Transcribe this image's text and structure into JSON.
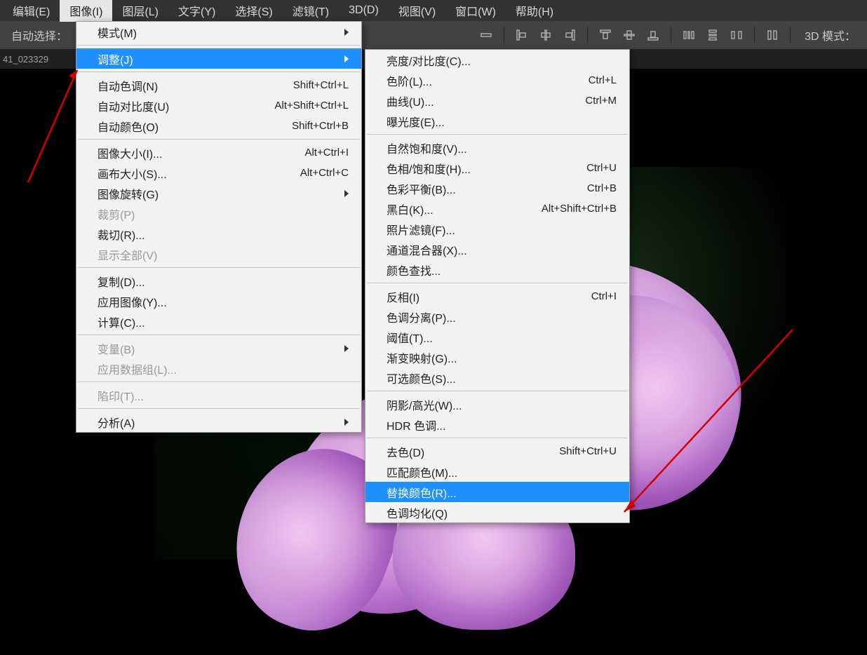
{
  "menubar": {
    "items": [
      {
        "label": "编辑(E)"
      },
      {
        "label": "图像(I)",
        "active": true
      },
      {
        "label": "图层(L)"
      },
      {
        "label": "文字(Y)"
      },
      {
        "label": "选择(S)"
      },
      {
        "label": "滤镜(T)"
      },
      {
        "label": "3D(D)"
      },
      {
        "label": "视图(V)"
      },
      {
        "label": "窗口(W)"
      },
      {
        "label": "帮助(H)"
      }
    ]
  },
  "optionsbar": {
    "auto_select_label": "自动选择：",
    "mode3d_label": "3D 模式："
  },
  "filetab": {
    "name": "41_023329"
  },
  "menu_main": {
    "items": [
      {
        "label": "模式(M)",
        "arrow": true
      },
      {
        "sep": true
      },
      {
        "label": "调整(J)",
        "arrow": true,
        "hover": true
      },
      {
        "sep": true
      },
      {
        "label": "自动色调(N)",
        "shortcut": "Shift+Ctrl+L"
      },
      {
        "label": "自动对比度(U)",
        "shortcut": "Alt+Shift+Ctrl+L"
      },
      {
        "label": "自动颜色(O)",
        "shortcut": "Shift+Ctrl+B"
      },
      {
        "sep": true
      },
      {
        "label": "图像大小(I)...",
        "shortcut": "Alt+Ctrl+I"
      },
      {
        "label": "画布大小(S)...",
        "shortcut": "Alt+Ctrl+C"
      },
      {
        "label": "图像旋转(G)",
        "arrow": true
      },
      {
        "label": "裁剪(P)",
        "disabled": true
      },
      {
        "label": "裁切(R)..."
      },
      {
        "label": "显示全部(V)",
        "disabled": true
      },
      {
        "sep": true
      },
      {
        "label": "复制(D)..."
      },
      {
        "label": "应用图像(Y)..."
      },
      {
        "label": "计算(C)..."
      },
      {
        "sep": true
      },
      {
        "label": "变量(B)",
        "arrow": true,
        "disabled": true
      },
      {
        "label": "应用数据组(L)...",
        "disabled": true
      },
      {
        "sep": true
      },
      {
        "label": "陷印(T)...",
        "disabled": true
      },
      {
        "sep": true
      },
      {
        "label": "分析(A)",
        "arrow": true
      }
    ]
  },
  "menu_sub": {
    "items": [
      {
        "label": "亮度/对比度(C)..."
      },
      {
        "label": "色阶(L)...",
        "shortcut": "Ctrl+L"
      },
      {
        "label": "曲线(U)...",
        "shortcut": "Ctrl+M"
      },
      {
        "label": "曝光度(E)..."
      },
      {
        "sep": true
      },
      {
        "label": "自然饱和度(V)..."
      },
      {
        "label": "色相/饱和度(H)...",
        "shortcut": "Ctrl+U"
      },
      {
        "label": "色彩平衡(B)...",
        "shortcut": "Ctrl+B"
      },
      {
        "label": "黑白(K)...",
        "shortcut": "Alt+Shift+Ctrl+B"
      },
      {
        "label": "照片滤镜(F)..."
      },
      {
        "label": "通道混合器(X)..."
      },
      {
        "label": "颜色查找..."
      },
      {
        "sep": true
      },
      {
        "label": "反相(I)",
        "shortcut": "Ctrl+I"
      },
      {
        "label": "色调分离(P)..."
      },
      {
        "label": "阈值(T)..."
      },
      {
        "label": "渐变映射(G)..."
      },
      {
        "label": "可选颜色(S)..."
      },
      {
        "sep": true
      },
      {
        "label": "阴影/高光(W)..."
      },
      {
        "label": "HDR 色调..."
      },
      {
        "sep": true
      },
      {
        "label": "去色(D)",
        "shortcut": "Shift+Ctrl+U"
      },
      {
        "label": "匹配颜色(M)..."
      },
      {
        "label": "替换颜色(R)...",
        "hover": true
      },
      {
        "label": "色调均化(Q)"
      }
    ]
  }
}
